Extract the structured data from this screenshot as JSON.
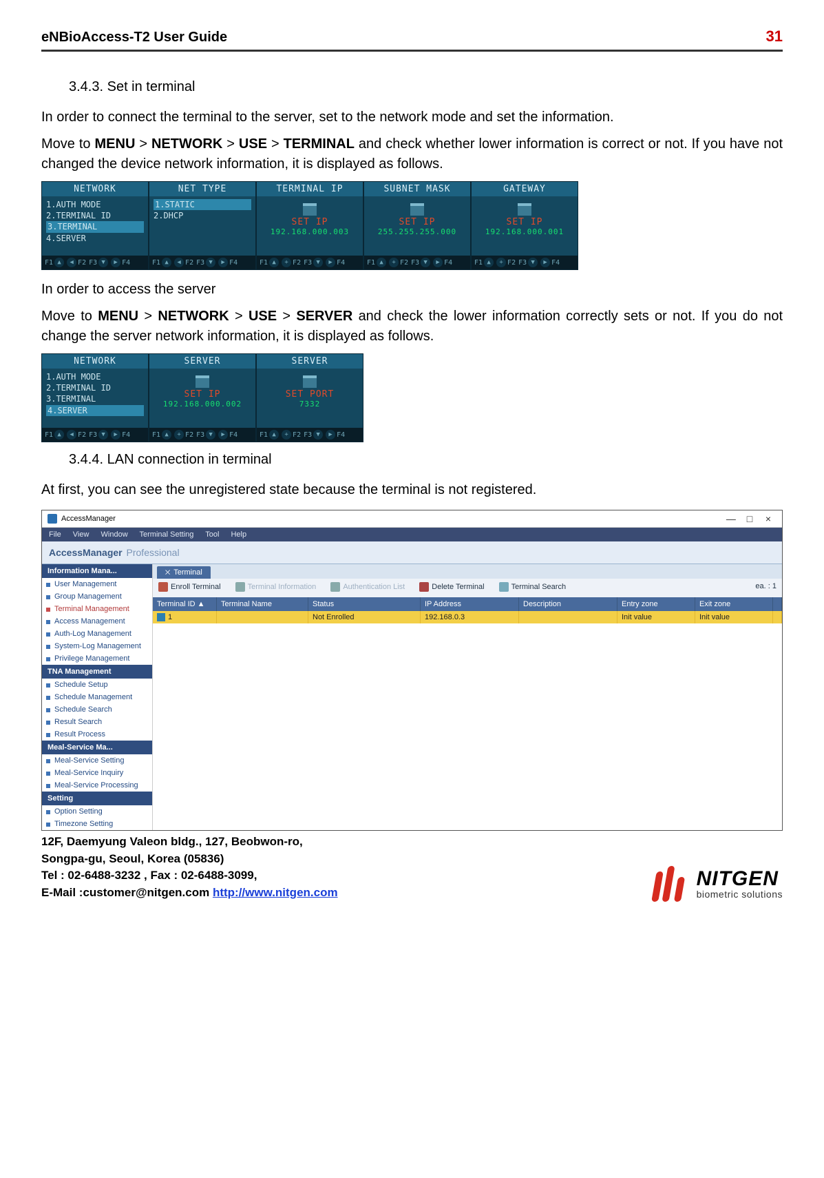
{
  "header": {
    "doc_title": "eNBioAccess-T2 User Guide",
    "page_no": "31"
  },
  "section1": {
    "num": "3.4.3.",
    "title": "Set in terminal",
    "p1": "In order to connect the terminal to the server, set to the network mode and set the information.",
    "p2a": "Move to ",
    "p2_menu": "MENU",
    "p2_g": " > ",
    "p2_net": "NETWORK",
    "p2_use": "USE",
    "p2_term": "TERMINAL",
    "p2b": " and check whether lower information is correct or not. If you have not changed the device network information, it is displayed as follows."
  },
  "row1": {
    "panel_keys": {
      "f1": "F1",
      "f2": "F2",
      "f3": "F3",
      "f4": "F4"
    },
    "p1": {
      "title": "NETWORK",
      "items": [
        "1.AUTH MODE",
        "2.TERMINAL ID",
        "3.TERMINAL",
        "4.SERVER"
      ],
      "sel": 2
    },
    "p2": {
      "title": "NET TYPE",
      "items": [
        "1.STATIC",
        "2.DHCP"
      ],
      "sel": 0
    },
    "p3": {
      "title": "TERMINAL IP",
      "set": "SET IP",
      "val": "192.168.000.003"
    },
    "p4": {
      "title": "SUBNET MASK",
      "set": "SET IP",
      "val": "255.255.255.000"
    },
    "p5": {
      "title": "GATEWAY",
      "set": "SET IP",
      "val": "192.168.000.001"
    }
  },
  "midtext": {
    "l1": "In order to access the server",
    "l2a": "Move to ",
    "menu": "MENU",
    "g": " > ",
    "net": "NETWORK",
    "use": "USE",
    "srv": "SERVER",
    "l2b": " and check the lower information correctly sets or not. If you do not change the server network information, it is displayed as follows."
  },
  "row2": {
    "p1": {
      "title": "NETWORK",
      "items": [
        "1.AUTH MODE",
        "2.TERMINAL ID",
        "3.TERMINAL",
        "4.SERVER"
      ],
      "sel": 3
    },
    "p2": {
      "title": "SERVER",
      "set": "SET IP",
      "val": "192.168.000.002"
    },
    "p3": {
      "title": "SERVER",
      "set": "SET PORT",
      "val": "7332"
    }
  },
  "section2": {
    "num": "3.4.4.",
    "title": "LAN connection in terminal",
    "p": "At first, you can see the unregistered state because the terminal is not registered."
  },
  "win": {
    "title": "AccessManager",
    "menus": [
      "File",
      "View",
      "Window",
      "Terminal Setting",
      "Tool",
      "Help"
    ],
    "brand": "AccessManager",
    "brand2": "Professional",
    "tab": "Terminal",
    "tools": {
      "enroll": "Enroll Terminal",
      "info": "Terminal Information",
      "auth": "Authentication List",
      "del": "Delete Terminal",
      "search": "Terminal Search",
      "count_label": "ea.  :",
      "count": "1"
    },
    "thead": [
      "Terminal ID ▲",
      "Terminal Name",
      "Status",
      "IP Address",
      "Description",
      "Entry zone",
      "Exit zone"
    ],
    "row": {
      "id": "1",
      "name": "",
      "status": "Not Enrolled",
      "ip": "192.168.0.3",
      "desc": "",
      "entry": "Init value",
      "exit": "Init value"
    },
    "side": {
      "g1": {
        "h": "Information Mana...",
        "items": [
          "User Management",
          "Group Management",
          "Terminal Management",
          "Access Management",
          "Auth-Log Management",
          "System-Log Management",
          "Privilege Management"
        ],
        "red": 2
      },
      "g2": {
        "h": "TNA Management",
        "items": [
          "Schedule Setup",
          "Schedule Management",
          "Schedule Search",
          "Result  Search",
          "Result Process"
        ]
      },
      "g3": {
        "h": "Meal-Service Ma...",
        "items": [
          "Meal-Service Setting",
          "Meal-Service Inquiry",
          "Meal-Service Processing"
        ]
      },
      "g4": {
        "h": "Setting",
        "items": [
          "Option Setting",
          "Timezone Setting"
        ]
      }
    },
    "ctrls": {
      "min": "—",
      "max": "□",
      "close": "×"
    }
  },
  "footer": {
    "l1": "12F, Daemyung Valeon bldg., 127, Beobwon-ro,",
    "l2": "Songpa-gu, Seoul, Korea (05836)",
    "l3": "Tel : 02-6488-3232 , Fax : 02-6488-3099,",
    "l4a": "E-Mail :customer@nitgen.com ",
    "l4link": "http://www.nitgen.com",
    "logo": "NITGEN",
    "tag": "biometric solutions"
  }
}
